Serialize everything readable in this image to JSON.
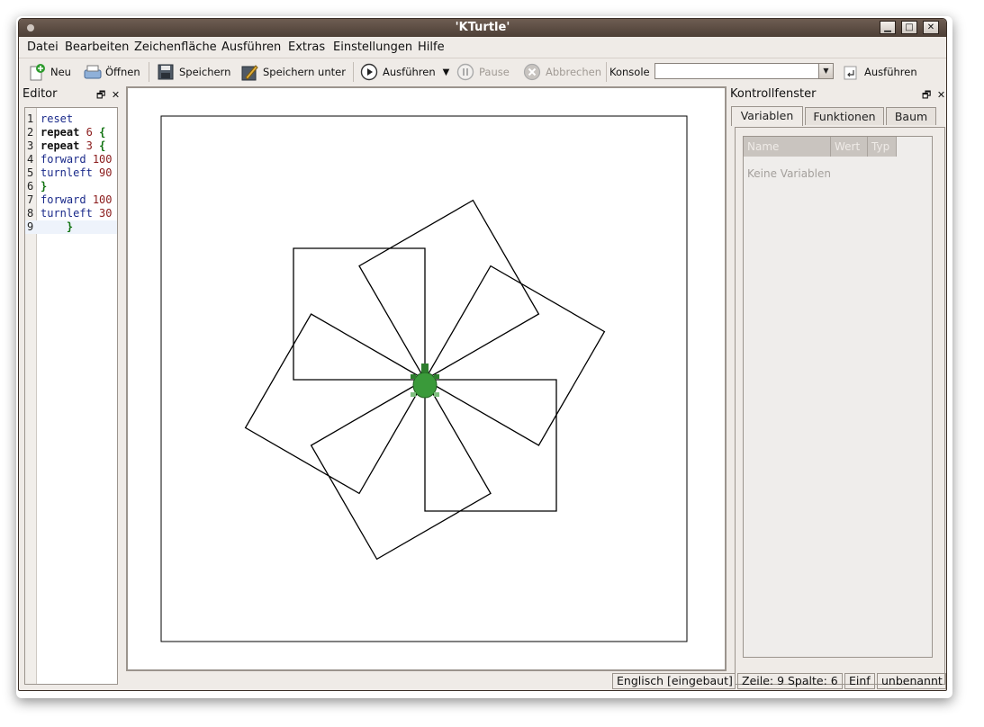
{
  "window": {
    "title": "'KTurtle'"
  },
  "menu": [
    "Datei",
    "Bearbeiten",
    "Zeichenfläche",
    "Ausführen",
    "Extras",
    "Einstellungen",
    "Hilfe"
  ],
  "toolbar": {
    "new": "Neu",
    "open": "Öffnen",
    "save": "Speichern",
    "save_as": "Speichern unter",
    "run": "Ausführen",
    "pause": "Pause",
    "abort": "Abbrechen",
    "console_label": "Konsole",
    "console_value": "",
    "console_run": "Ausführen"
  },
  "editor": {
    "title": "Editor",
    "lines": [
      {
        "n": "1",
        "tokens": [
          [
            "cmd",
            "reset"
          ]
        ]
      },
      {
        "n": "2",
        "tokens": [
          [
            "kw",
            "repeat"
          ],
          [
            "t",
            " "
          ],
          [
            "num",
            "6"
          ],
          [
            "t",
            " "
          ],
          [
            "brace",
            "{"
          ]
        ]
      },
      {
        "n": "3",
        "tokens": [
          [
            "kw",
            "repeat"
          ],
          [
            "t",
            " "
          ],
          [
            "num",
            "3"
          ],
          [
            "t",
            " "
          ],
          [
            "brace",
            "{"
          ]
        ]
      },
      {
        "n": "4",
        "tokens": [
          [
            "cmd",
            "forward"
          ],
          [
            "t",
            " "
          ],
          [
            "num",
            "100"
          ]
        ]
      },
      {
        "n": "5",
        "tokens": [
          [
            "cmd",
            "turnleft"
          ],
          [
            "t",
            " "
          ],
          [
            "num",
            "90"
          ]
        ]
      },
      {
        "n": "6",
        "tokens": [
          [
            "brace",
            "}"
          ]
        ]
      },
      {
        "n": "7",
        "tokens": [
          [
            "cmd",
            "forward"
          ],
          [
            "t",
            " "
          ],
          [
            "num",
            "100"
          ]
        ]
      },
      {
        "n": "8",
        "tokens": [
          [
            "cmd",
            "turnleft"
          ],
          [
            "t",
            " "
          ],
          [
            "num",
            "30"
          ]
        ]
      },
      {
        "n": "9",
        "tokens": [
          [
            "t",
            "    "
          ],
          [
            "brace",
            "}"
          ]
        ]
      }
    ]
  },
  "canvas": {
    "drawing": {
      "squares": 6,
      "rotation_step_deg": 60,
      "inner_turn_deg": 90,
      "side": 100,
      "line_color": "#000000"
    },
    "turtle_color": "#3a9a3a"
  },
  "control_panel": {
    "title": "Kontrollfenster",
    "tabs": [
      "Variablen",
      "Funktionen",
      "Baum"
    ],
    "columns": [
      "Name",
      "Wert",
      "Typ"
    ],
    "empty_text": "Keine Variablen"
  },
  "status": {
    "language": "Englisch [eingebaut]",
    "position": "Zeile: 9 Spalte: 6",
    "mode": "Einf",
    "file": "unbenannt"
  },
  "colors": {
    "titlebar": "#5a4a40",
    "chrome": "#efebe7"
  }
}
